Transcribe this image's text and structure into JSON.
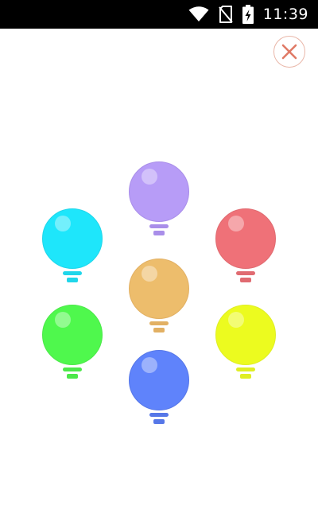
{
  "status_bar": {
    "time": "11:39",
    "icons": [
      "wifi-icon",
      "no-sim-icon",
      "battery-charging-icon"
    ]
  },
  "close_icon": "close-icon",
  "colors": {
    "close": "#e07a66",
    "close_ring": "#e9b6a8"
  },
  "bulbs": [
    {
      "name": "purple",
      "glass": "#b79cf7",
      "base": "#a98ee9"
    },
    {
      "name": "cyan",
      "glass": "#1ee6fb",
      "base": "#20d6ea"
    },
    {
      "name": "red",
      "glass": "#ef7178",
      "base": "#e06b71"
    },
    {
      "name": "orange",
      "glass": "#edbd6c",
      "base": "#e2b063"
    },
    {
      "name": "green",
      "glass": "#4ff84d",
      "base": "#4ce84a"
    },
    {
      "name": "yellow",
      "glass": "#ecfb1f",
      "base": "#dfee25"
    },
    {
      "name": "blue",
      "glass": "#5f83fb",
      "base": "#5677e8"
    }
  ]
}
